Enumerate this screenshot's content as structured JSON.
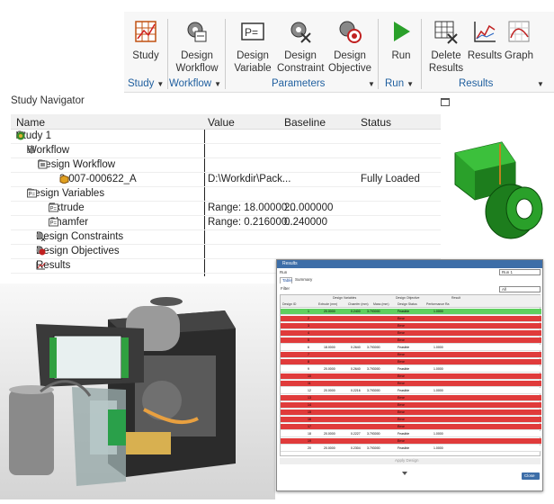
{
  "ribbon": {
    "buttons": {
      "study": "Study",
      "design_workflow": [
        "Design",
        "Workflow"
      ],
      "design_variable": [
        "Design",
        "Variable"
      ],
      "design_constraint": [
        "Design",
        "Constraint"
      ],
      "design_objective": [
        "Design",
        "Objective"
      ],
      "run": "Run",
      "delete_results": [
        "Delete",
        "Results"
      ],
      "results": "Results",
      "graph": "Graph"
    },
    "groups": {
      "study": "Study",
      "workflow": "Workflow",
      "parameters": "Parameters",
      "run": "Run",
      "results": "Results"
    }
  },
  "navigator": {
    "title": "Study Navigator",
    "columns": [
      "Name",
      "Value",
      "Baseline",
      "Status"
    ],
    "rows": [
      {
        "name": "Study 1",
        "value": "",
        "baseline": "",
        "status": ""
      },
      {
        "name": "Workflow",
        "value": "",
        "baseline": "",
        "status": ""
      },
      {
        "name": "Design Workflow",
        "value": "",
        "baseline": "",
        "status": ""
      },
      {
        "name": "3-007-000622_A",
        "value": "D:\\Workdir\\Pack...",
        "baseline": "",
        "status": "Fully Loaded"
      },
      {
        "name": "Design Variables",
        "value": "",
        "baseline": "",
        "status": ""
      },
      {
        "name": "Extrude",
        "value": "Range: 18.00000...",
        "baseline": "20.000000",
        "status": ""
      },
      {
        "name": "Chamfer",
        "value": "Range: 0.216000...",
        "baseline": "0.240000",
        "status": ""
      },
      {
        "name": "Design Constraints",
        "value": "",
        "baseline": "",
        "status": ""
      },
      {
        "name": "Design Objectives",
        "value": "",
        "baseline": "",
        "status": ""
      },
      {
        "name": "Results",
        "value": "",
        "baseline": "",
        "status": ""
      }
    ]
  },
  "results_window": {
    "title": "Results",
    "run_label": "Run",
    "run_select": "Run 1",
    "tabs": [
      "Table",
      "Summary"
    ],
    "filter_label": "Filter",
    "filter_select": "All",
    "group_headers": [
      "Design Variables",
      "Design Objective",
      "Result"
    ],
    "columns": [
      "Design ID",
      "Extrude (mm)",
      "Chamfer (mm)",
      "Mass (mm)",
      "Design Status",
      "Performance Ra"
    ],
    "bottom_button": "Apply Design",
    "close_button": "Close",
    "rows": [
      {
        "id": "1",
        "status": "Feasible",
        "highlight": "green",
        "extrude": "20.0000",
        "chamfer": "0.2400",
        "mass": "3.793000"
      },
      {
        "id": "2",
        "status": "Error",
        "highlight": "red",
        "extrude": "",
        "chamfer": "",
        "mass": ""
      },
      {
        "id": "3",
        "status": "Error",
        "highlight": "red",
        "extrude": "",
        "chamfer": "",
        "mass": ""
      },
      {
        "id": "4",
        "status": "Error",
        "highlight": "red",
        "extrude": "",
        "chamfer": "",
        "mass": ""
      },
      {
        "id": "5",
        "status": "Error",
        "highlight": "red",
        "extrude": "",
        "chamfer": "",
        "mass": ""
      },
      {
        "id": "6",
        "status": "Feasible",
        "highlight": "white",
        "extrude": "18.0000",
        "chamfer": "0.2640",
        "mass": "3.793000"
      },
      {
        "id": "7",
        "status": "Error",
        "highlight": "red",
        "extrude": "",
        "chamfer": "",
        "mass": ""
      },
      {
        "id": "8",
        "status": "Error",
        "highlight": "red",
        "extrude": "",
        "chamfer": "",
        "mass": ""
      },
      {
        "id": "9",
        "status": "Feasible",
        "highlight": "white",
        "extrude": "20.0000",
        "chamfer": "0.2640",
        "mass": "3.793000"
      },
      {
        "id": "10",
        "status": "Error",
        "highlight": "red",
        "extrude": "",
        "chamfer": "",
        "mass": ""
      },
      {
        "id": "11",
        "status": "Error",
        "highlight": "red",
        "extrude": "",
        "chamfer": "",
        "mass": ""
      },
      {
        "id": "12",
        "status": "Feasible",
        "highlight": "white",
        "extrude": "20.0000",
        "chamfer": "0.2216",
        "mass": "3.793000"
      },
      {
        "id": "13",
        "status": "Error",
        "highlight": "red",
        "extrude": "",
        "chamfer": "",
        "mass": ""
      },
      {
        "id": "14",
        "status": "Error",
        "highlight": "red",
        "extrude": "",
        "chamfer": "",
        "mass": ""
      },
      {
        "id": "15",
        "status": "Error",
        "highlight": "red",
        "extrude": "",
        "chamfer": "",
        "mass": ""
      },
      {
        "id": "16",
        "status": "Error",
        "highlight": "red",
        "extrude": "",
        "chamfer": "",
        "mass": ""
      },
      {
        "id": "17",
        "status": "Error",
        "highlight": "red",
        "extrude": "",
        "chamfer": "",
        "mass": ""
      },
      {
        "id": "18",
        "status": "Feasible",
        "highlight": "white",
        "extrude": "20.0000",
        "chamfer": "0.2227",
        "mass": "3.793000"
      },
      {
        "id": "19",
        "status": "Error",
        "highlight": "red",
        "extrude": "",
        "chamfer": "",
        "mass": ""
      },
      {
        "id": "20",
        "status": "Feasible",
        "highlight": "white",
        "extrude": "20.0000",
        "chamfer": "0.2304",
        "mass": "3.793000"
      }
    ],
    "performance_values": [
      "1.0000",
      "",
      "",
      "",
      "",
      "1.0000",
      "",
      "",
      "1.0000",
      "",
      "",
      "1.0000",
      "",
      "",
      "",
      "",
      "",
      "1.0000",
      "",
      "1.0000"
    ]
  },
  "colors": {
    "row_red": "#e03b3b",
    "row_green": "#5fcf5f",
    "title_bar": "#3d6ea8",
    "group_label": "#1f5f9f",
    "model_green": "#2aa02a"
  }
}
